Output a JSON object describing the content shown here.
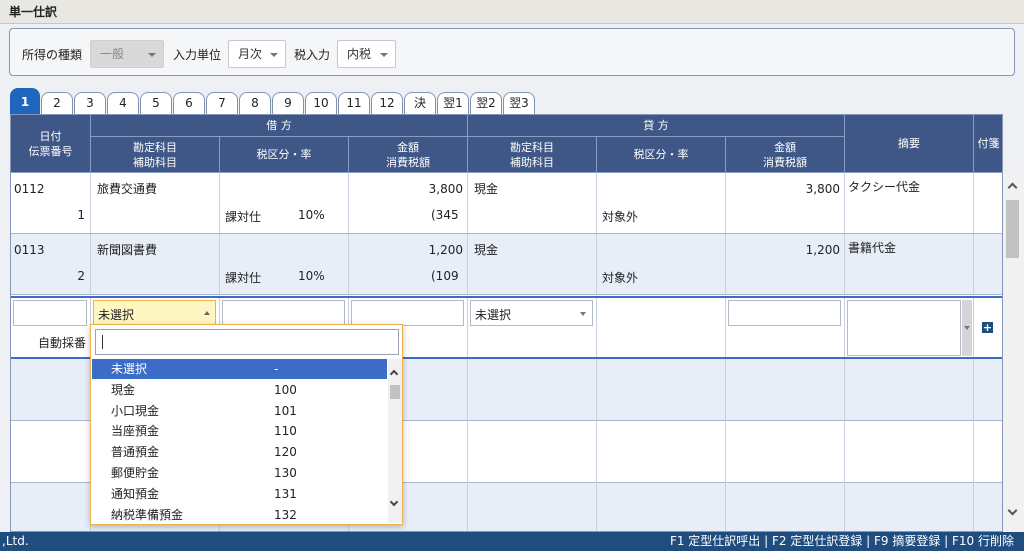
{
  "window": {
    "title": "単一仕訳"
  },
  "filters": {
    "income_type_label": "所得の種類",
    "income_type_value": "一般",
    "input_unit_label": "入力単位",
    "input_unit_value": "月次",
    "tax_input_label": "税入力",
    "tax_input_value": "内税"
  },
  "tabs": [
    "1",
    "2",
    "3",
    "4",
    "5",
    "6",
    "7",
    "8",
    "9",
    "10",
    "11",
    "12",
    "決",
    "翌1",
    "翌2",
    "翌3"
  ],
  "active_tab": "1",
  "header": {
    "date": "日付",
    "voucher": "伝票番号",
    "debit": "借 方",
    "credit": "貸 方",
    "account": "勘定科目",
    "sub_account": "補助科目",
    "tax_class": "税区分・率",
    "amount": "金額",
    "tax_amount": "消費税額",
    "memo": "摘要",
    "attachment": "付箋"
  },
  "rows": [
    {
      "date": "0112",
      "voucher": "1",
      "debit_account": "旅費交通費",
      "debit_tax": "課対仕",
      "debit_rate": "10%",
      "debit_amount": "3,800",
      "debit_tax_amount": "(345",
      "credit_account": "現金",
      "credit_tax": "対象外",
      "credit_amount": "3,800",
      "memo": "タクシー代金"
    },
    {
      "date": "0113",
      "voucher": "2",
      "debit_account": "新聞図書費",
      "debit_tax": "課対仕",
      "debit_rate": "10%",
      "debit_amount": "1,200",
      "debit_tax_amount": "(109",
      "credit_account": "現金",
      "credit_tax": "対象外",
      "credit_amount": "1,200",
      "memo": "書籍代金"
    }
  ],
  "edit_row": {
    "auto_number": "自動採番",
    "debit_account": "未選択",
    "credit_account": "未選択",
    "add_icon": "plus-icon"
  },
  "dropdown": {
    "search_value": "",
    "items": [
      {
        "name": "未選択",
        "code": "-"
      },
      {
        "name": "現金",
        "code": "100"
      },
      {
        "name": "小口現金",
        "code": "101"
      },
      {
        "name": "当座預金",
        "code": "110"
      },
      {
        "name": "普通預金",
        "code": "120"
      },
      {
        "name": "郵便貯金",
        "code": "130"
      },
      {
        "name": "通知預金",
        "code": "131"
      },
      {
        "name": "納税準備預金",
        "code": "132"
      }
    ]
  },
  "statusbar": {
    "left": ",Ltd.",
    "shortcuts": "F1 定型仕訳呼出 | F2 定型仕訳登録 | F9 摘要登録 | F10 行削除"
  },
  "colors": {
    "header": "#3e5787",
    "accent": "#1f66bf",
    "highlight_row": "#e7eef8",
    "statusbar": "#1f4d80",
    "dropdown_border": "#f1b04f"
  }
}
